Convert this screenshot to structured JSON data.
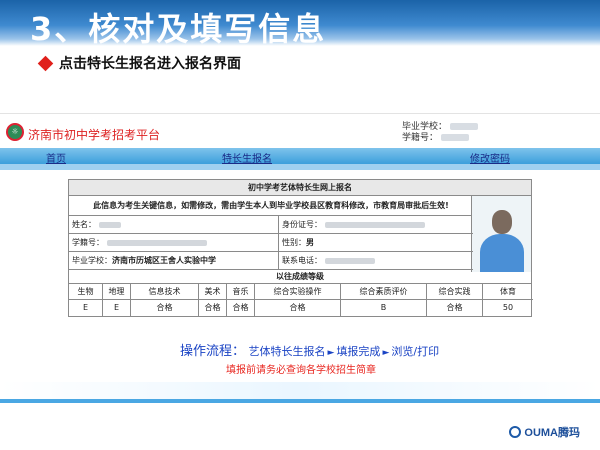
{
  "slide": {
    "title": "3、核对及填写信息",
    "bullet": "点击特长生报名进入报名界面"
  },
  "site": {
    "name": "济南市初中学考招考平台",
    "school_label": "毕业学校：",
    "id_label": "学籍号："
  },
  "nav": {
    "home": "首页",
    "special": "特长生报名",
    "change_pwd": "修改密码"
  },
  "form": {
    "title": "初中学考艺体特长生网上报名",
    "notice": "此信息为考生关键信息，如需修改，需由学生本人到毕业学校县区教育科修改，市教育局审批后生效!",
    "name_label": "姓名：",
    "idcard_label": "身份证号：",
    "student_id_label": "学籍号：",
    "gender_label": "性别：",
    "gender_value": "男",
    "school_label": "毕业学校：",
    "school_value": "济南市历城区王舍人实验中学",
    "phone_label": "联系电话：",
    "grades_title": "以往成绩等级",
    "grade_headers": [
      "生物",
      "地理",
      "信息技术",
      "美术",
      "音乐",
      "综合实验操作",
      "综合素质评价",
      "综合实践",
      "体育"
    ],
    "grade_values": [
      "E",
      "E",
      "合格",
      "合格",
      "合格",
      "合格",
      "B",
      "合格",
      "50"
    ]
  },
  "flow": {
    "label": "操作流程：",
    "step1": "艺体特长生报名",
    "step2": "填报完成",
    "step3": "浏览/打印"
  },
  "warning": "填报前请务必查询各学校招生简章",
  "brand": "OUMA腾玛",
  "colors": {
    "header_blue": "#1b63a8",
    "accent_red": "#e0201b",
    "link_blue": "#1a43c4"
  }
}
